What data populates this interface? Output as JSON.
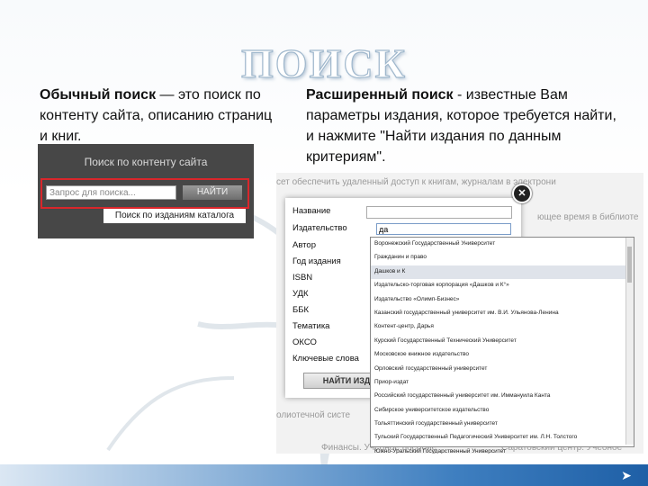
{
  "title": "ПОИСК",
  "left": {
    "lead": "Обычный поиск",
    "rest": " — это поиск по контенту сайта, описанию страниц и книг."
  },
  "right": {
    "lead": "Расширенный поиск",
    "rest": " - известные Вам параметры издания, которое требуется найти, и нажмите \"Найти издания по данным критериям\"."
  },
  "simple_search": {
    "title": "Поиск по контенту сайта",
    "placeholder": "Запрос для поиска...",
    "button": "НАЙТИ",
    "catalog_link": "Поиск по изданиям каталога"
  },
  "advanced_search": {
    "background_text": {
      "top": "сет    обеспечить удаленный   доступ   к книгам,  журналам   в электрони",
      "mid": "ющее время  в библиоте",
      "bottom": "олиотечной систе",
      "footer_left": "Финансы. Учебное пособие",
      "footer_right": "Саратовский центр. Учебное"
    },
    "fields": [
      "Название",
      "Издательство",
      "Автор",
      "Год издания",
      "ISBN",
      "УДК",
      "ББК",
      "Тематика",
      "ОКСО",
      "Ключевые слова"
    ],
    "publisher_value": "да",
    "find_button": "НАЙТИ ИЗДАНИЯ",
    "close": "✕",
    "suggestions": [
      "Воронежский Государственный Университет",
      "Гражданин и право",
      "Дашков и К",
      "Издательско-торговая корпорация «Дашков и К°»",
      "Издательство «Олимп-Бизнес»",
      "Казанский государственный университет им. В.И. Ульянова-Ленина",
      "Контент-центр, Дарья",
      "Курский Государственный Технический Университет",
      "Московское книжное издательство",
      "Орловский государственный университет",
      "Приор-издат",
      "Российский государственный университет им. Иммануила Канта",
      "Сибирское университетское издательство",
      "Тольяттинский государственный университет",
      "Тульский Государственный Педагогический Университет им. Л.Н. Толстого",
      "Южно-Уральский Государственный Университет"
    ],
    "selected_index": 2
  },
  "colors": {
    "accent_red": "#d9262b",
    "footer_blue": "#1e5fa6"
  }
}
